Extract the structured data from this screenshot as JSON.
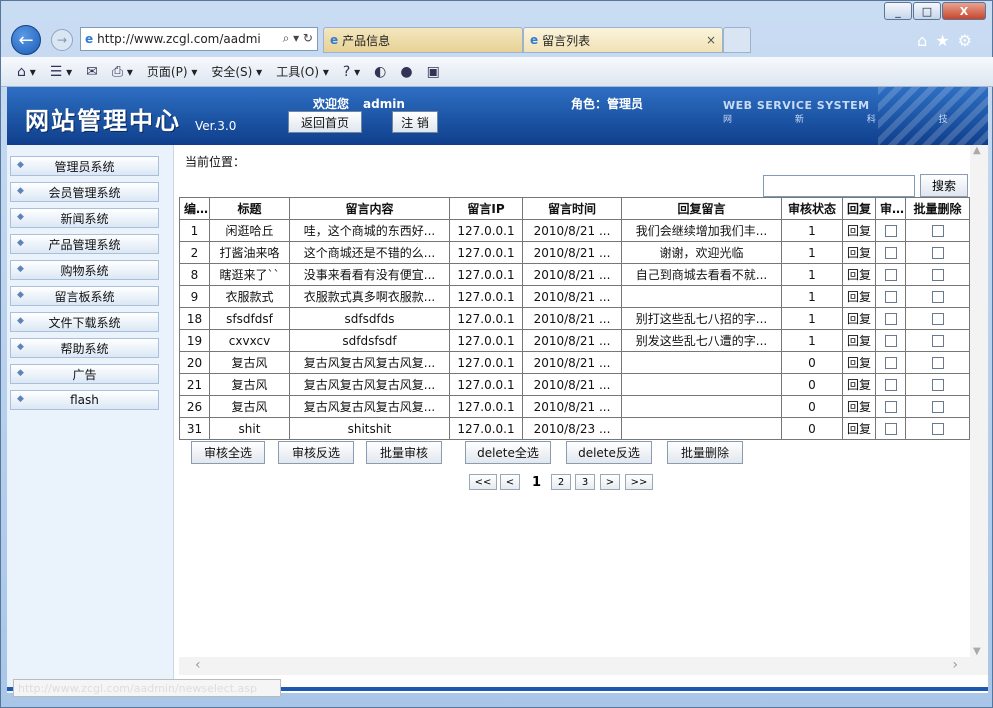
{
  "browser": {
    "window_buttons": [
      "_",
      "□",
      "X"
    ],
    "address": "http://www.zcgl.com/aadmi",
    "tabs": [
      {
        "label": "产品信息"
      },
      {
        "label": "留言列表"
      }
    ],
    "cmdbar": {
      "page": "页面(P)",
      "safety": "安全(S)",
      "tools": "工具(O)"
    },
    "status_text": "http://www.zcgl.com/aadmin/newselect.asp"
  },
  "header": {
    "logo": "网站管理中心",
    "version": "Ver.3.0",
    "welcome": "欢迎您",
    "user": "admin",
    "home_button": "返回首页",
    "logout_button": "注 销",
    "role": "角色：管理员",
    "brand": "WEB SERVICE SYSTEM",
    "brand_sub": "网 新 科 技"
  },
  "sidebar": {
    "items": [
      {
        "label": "管理员系统"
      },
      {
        "label": "会员管理系统"
      },
      {
        "label": "新闻系统"
      },
      {
        "label": "产品管理系统"
      },
      {
        "label": "购物系统"
      },
      {
        "label": "留言板系统"
      },
      {
        "label": "文件下载系统"
      },
      {
        "label": "帮助系统"
      },
      {
        "label": "广告"
      },
      {
        "label": "flash"
      }
    ]
  },
  "main": {
    "location_label": "当前位置：",
    "search_button": "搜索",
    "table": {
      "headers": [
        "编号",
        "标题",
        "留言内容",
        "留言IP",
        "留言时间",
        "回复留言",
        "审核状态",
        "回复",
        "审核",
        "批量删除"
      ],
      "rows": [
        {
          "id": "1",
          "title": "闲逛哈丘",
          "content": "哇，这个商城的东西好...",
          "ip": "127.0.0.1",
          "time": "2010/8/21 ...",
          "reply_text": "我们会继续增加我们丰...",
          "status": "1",
          "reply": "回复"
        },
        {
          "id": "2",
          "title": "打酱油来咯",
          "content": "这个商城还是不错的么...",
          "ip": "127.0.0.1",
          "time": "2010/8/21 ...",
          "reply_text": "谢谢，欢迎光临",
          "status": "1",
          "reply": "回复"
        },
        {
          "id": "8",
          "title": "瞎逛来了``",
          "content": "没事来看看有没有便宜...",
          "ip": "127.0.0.1",
          "time": "2010/8/21 ...",
          "reply_text": "自己到商城去看看不就...",
          "status": "1",
          "reply": "回复"
        },
        {
          "id": "9",
          "title": "衣服款式",
          "content": "衣服款式真多啊衣服款...",
          "ip": "127.0.0.1",
          "time": "2010/8/21 ...",
          "reply_text": "",
          "status": "1",
          "reply": "回复"
        },
        {
          "id": "18",
          "title": "sfsdfdsf",
          "content": "sdfsdfds",
          "ip": "127.0.0.1",
          "time": "2010/8/21 ...",
          "reply_text": "别打这些乱七八招的字...",
          "status": "1",
          "reply": "回复"
        },
        {
          "id": "19",
          "title": "cxvxcv",
          "content": "sdfdsfsdf",
          "ip": "127.0.0.1",
          "time": "2010/8/21 ...",
          "reply_text": "别发这些乱七八遭的字...",
          "status": "1",
          "reply": "回复"
        },
        {
          "id": "20",
          "title": "复古风",
          "content": "复古风复古风复古风复...",
          "ip": "127.0.0.1",
          "time": "2010/8/21 ...",
          "reply_text": "",
          "status": "0",
          "reply": "回复"
        },
        {
          "id": "21",
          "title": "复古风",
          "content": "复古风复古风复古风复...",
          "ip": "127.0.0.1",
          "time": "2010/8/21 ...",
          "reply_text": "",
          "status": "0",
          "reply": "回复"
        },
        {
          "id": "26",
          "title": "复古风",
          "content": "复古风复古风复古风复...",
          "ip": "127.0.0.1",
          "time": "2010/8/21 ...",
          "reply_text": "",
          "status": "0",
          "reply": "回复"
        },
        {
          "id": "31",
          "title": "shit",
          "content": "shitshit",
          "ip": "127.0.0.1",
          "time": "2010/8/23 ...",
          "reply_text": "",
          "status": "0",
          "reply": "回复"
        }
      ]
    },
    "actions": {
      "audit_all": "审核全选",
      "audit_invert": "审核反选",
      "batch_audit": "批量审核",
      "delete_all": "delete全选",
      "delete_invert": "delete反选",
      "batch_delete": "批量删除"
    },
    "pager": {
      "first": "<<",
      "prev": "<",
      "current": "1",
      "p2": "2",
      "p3": "3",
      "next": ">",
      "last": ">>"
    }
  }
}
